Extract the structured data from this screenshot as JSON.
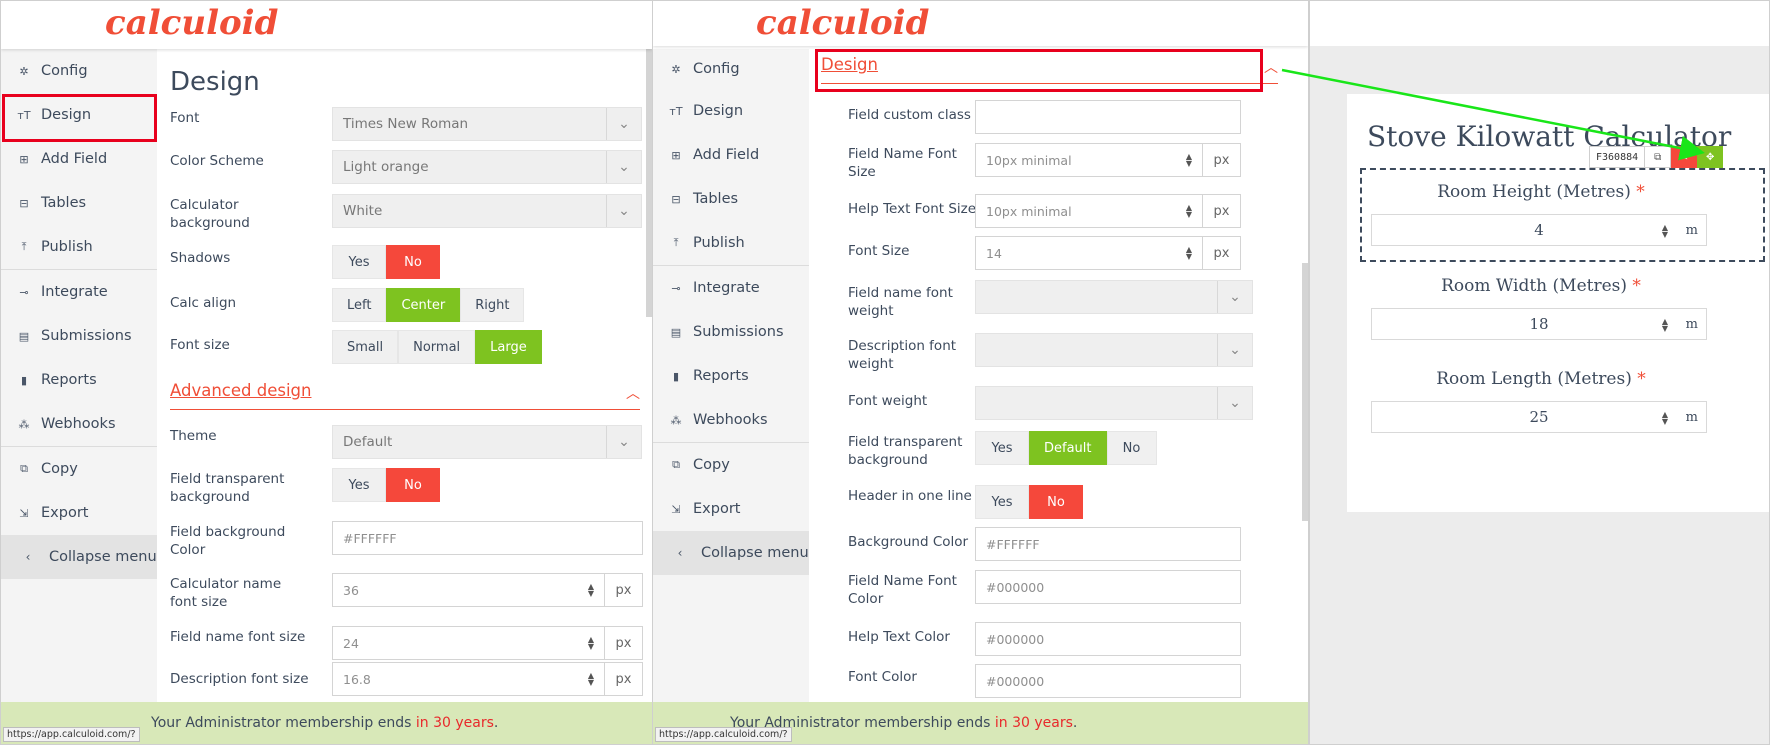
{
  "brand": {
    "logo": "calculoid"
  },
  "nav": [
    {
      "label": "Config",
      "icon": "gear-icon",
      "glyph": "✲"
    },
    {
      "label": "Design",
      "icon": "text-size-icon",
      "glyph": "ᴛT"
    },
    {
      "label": "Add Field",
      "icon": "plus-square-icon",
      "glyph": "⊞"
    },
    {
      "label": "Tables",
      "icon": "table-icon",
      "glyph": "⊟"
    },
    {
      "label": "Publish",
      "icon": "upload-icon",
      "glyph": "⤒"
    },
    {
      "label": "Integrate",
      "icon": "integrate-icon",
      "glyph": "⊸"
    },
    {
      "label": "Submissions",
      "icon": "inbox-icon",
      "glyph": "▤"
    },
    {
      "label": "Reports",
      "icon": "bar-chart-icon",
      "glyph": "▮"
    },
    {
      "label": "Webhooks",
      "icon": "webhook-icon",
      "glyph": "⁂"
    },
    {
      "label": "Copy",
      "icon": "copy-icon",
      "glyph": "⧉"
    },
    {
      "label": "Export",
      "icon": "export-icon",
      "glyph": "⇲"
    },
    {
      "label": "Collapse menu",
      "icon": "chevron-left-icon",
      "glyph": "‹"
    }
  ],
  "pane1": {
    "title": "Design",
    "font_label": "Font",
    "font_value": "Times New Roman",
    "scheme_label": "Color Scheme",
    "scheme_value": "Light orange",
    "bg_label": "Calculator background",
    "bg_value": "White",
    "shadows_label": "Shadows",
    "shadows_opts": [
      "Yes",
      "No"
    ],
    "align_label": "Calc align",
    "align_opts": [
      "Left",
      "Center",
      "Right"
    ],
    "fontsize_label": "Font size",
    "fontsize_opts": [
      "Small",
      "Normal",
      "Large"
    ],
    "adv_title": "Advanced design",
    "theme_label": "Theme",
    "theme_value": "Default",
    "transp_label": "Field transparent background",
    "transp_opts": [
      "Yes",
      "No"
    ],
    "fieldbg_label": "Field background Color",
    "fieldbg_placeholder": "#FFFFFF",
    "calcname_label": "Calculator name font size",
    "calcname_value": "36",
    "fieldname_label": "Field name font size",
    "fieldname_value": "24",
    "desc_label": "Description font size",
    "desc_value": "16.8",
    "unit": "px"
  },
  "pane2": {
    "section_title": "Design",
    "custom_class_label": "Field custom class",
    "fname_size_label": "Field Name Font Size",
    "fname_size_placeholder": "10px minimal",
    "help_size_label": "Help Text Font Size",
    "help_size_placeholder": "10px minimal",
    "font_size_label": "Font Size",
    "font_size_value": "14",
    "fname_weight_label": "Field name font weight",
    "desc_weight_label": "Description font weight",
    "font_weight_label": "Font weight",
    "transp_label": "Field transparent background",
    "transp_opts": [
      "Yes",
      "Default",
      "No"
    ],
    "header_label": "Header in one line",
    "header_opts": [
      "Yes",
      "No"
    ],
    "bgcolor_label": "Background Color",
    "bgcolor_placeholder": "#FFFFFF",
    "fname_color_label": "Field Name Font Color",
    "fname_color_placeholder": "#000000",
    "help_color_label": "Help Text Color",
    "help_color_placeholder": "#000000",
    "font_color_label": "Font Color",
    "font_color_placeholder": "#000000",
    "unit": "px"
  },
  "footer": {
    "prefix": "Your Administrator membership ends ",
    "highlight": "in 30 years",
    "suffix": "."
  },
  "status_url": "https://app.calculoid.com/?",
  "preview": {
    "title": "Stove Kilowatt Calculator",
    "field_id": "F360884",
    "fields": [
      {
        "label": "Room Height (Metres)",
        "value": "4",
        "unit": "m"
      },
      {
        "label": "Room Width (Metres)",
        "value": "18",
        "unit": "m"
      },
      {
        "label": "Room Length (Metres)",
        "value": "25",
        "unit": "m"
      }
    ],
    "required_mark": "*"
  },
  "colors": {
    "brand": "#f04e37",
    "active_red": "#f5483b",
    "active_green": "#7ec320",
    "annotation": "#e8001d",
    "arrow": "#19e619",
    "footer_bg": "#d8e8b8"
  }
}
